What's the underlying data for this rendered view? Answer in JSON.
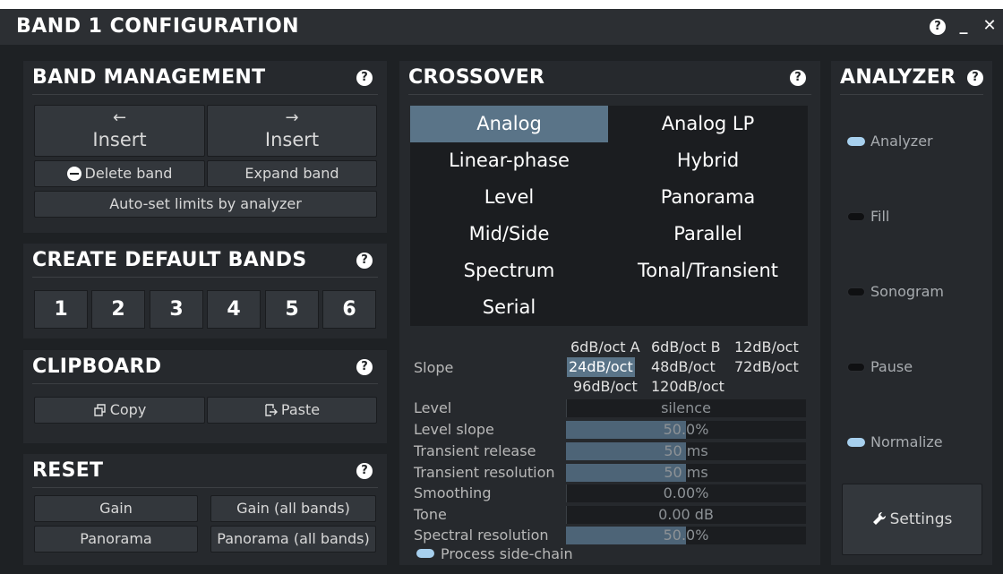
{
  "window": {
    "title": "BAND 1 CONFIGURATION",
    "help_glyph": "?",
    "minimize_glyph": "_",
    "close_glyph": "✕"
  },
  "band_management": {
    "title": "BAND MANAGEMENT",
    "insert_left": {
      "arrow": "←",
      "label": "Insert"
    },
    "insert_right": {
      "arrow": "→",
      "label": "Insert"
    },
    "delete_band": "Delete band",
    "expand_band": "Expand band",
    "auto_set": "Auto-set limits by analyzer"
  },
  "create_default_bands": {
    "title": "CREATE DEFAULT BANDS",
    "buttons": [
      "1",
      "2",
      "3",
      "4",
      "5",
      "6"
    ]
  },
  "clipboard": {
    "title": "CLIPBOARD",
    "copy": "Copy",
    "paste": "Paste"
  },
  "reset": {
    "title": "RESET",
    "gain": "Gain",
    "gain_all": "Gain (all bands)",
    "panorama": "Panorama",
    "panorama_all": "Panorama (all bands)"
  },
  "crossover": {
    "title": "CROSSOVER",
    "types": [
      "Analog",
      "Analog LP",
      "Linear-phase",
      "Hybrid",
      "Level",
      "Panorama",
      "Mid/Side",
      "Parallel",
      "Spectrum",
      "Tonal/Transient",
      "Serial"
    ],
    "selected_type": "Analog",
    "slope": {
      "label": "Slope",
      "options": [
        "6dB/oct A",
        "6dB/oct B",
        "12dB/oct",
        "24dB/oct",
        "48dB/oct",
        "72dB/oct",
        "96dB/oct",
        "120dB/oct"
      ],
      "selected": "24dB/oct"
    },
    "params": [
      {
        "label": "Level",
        "value": "silence",
        "fill": 0.0
      },
      {
        "label": "Level slope",
        "value": "50.0%",
        "fill": 0.5
      },
      {
        "label": "Transient release",
        "value": "50 ms",
        "fill": 0.5
      },
      {
        "label": "Transient resolution",
        "value": "50 ms",
        "fill": 0.5
      },
      {
        "label": "Smoothing",
        "value": "0.00%",
        "fill": 0.0
      },
      {
        "label": "Tone",
        "value": "0.00 dB",
        "fill": 0.0
      },
      {
        "label": "Spectral resolution",
        "value": "50.0%",
        "fill": 0.5
      }
    ],
    "process_sidechain": {
      "label": "Process side-chain",
      "on": true
    }
  },
  "analyzer": {
    "title": "ANALYZER",
    "toggles": [
      {
        "label": "Analyzer",
        "on": true
      },
      {
        "label": "Fill",
        "on": false
      },
      {
        "label": "Sonogram",
        "on": false
      },
      {
        "label": "Pause",
        "on": false
      },
      {
        "label": "Normalize",
        "on": true
      }
    ],
    "settings": "Settings"
  },
  "colors": {
    "accent": "#5a7488",
    "toggle_on": "#a7d0ee",
    "background": "#1e2124"
  }
}
